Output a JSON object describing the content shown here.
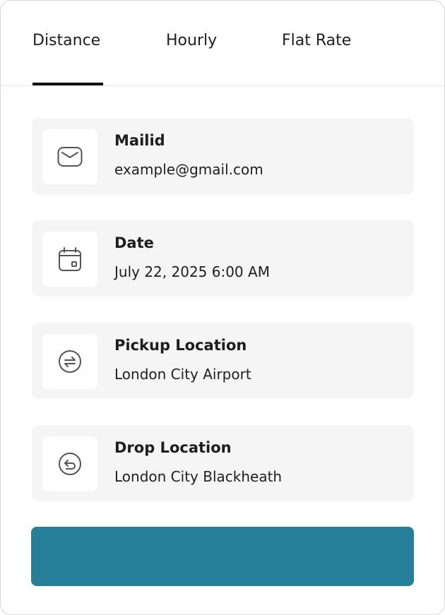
{
  "tabs": [
    {
      "label": "Distance",
      "active": true
    },
    {
      "label": "Hourly",
      "active": false
    },
    {
      "label": "Flat Rate",
      "active": false
    }
  ],
  "fields": [
    {
      "label": "Mailid",
      "value": "example@gmail.com",
      "icon": "mail-icon"
    },
    {
      "label": "Date",
      "value": "July 22, 2025 6:00 AM",
      "icon": "calendar-icon"
    },
    {
      "label": "Pickup Location",
      "value": "London City Airport",
      "icon": "pickup-location-icon"
    },
    {
      "label": "Drop Location",
      "value": "London City Blackheath",
      "icon": "drop-location-icon"
    }
  ],
  "submit_button": {
    "label": ""
  },
  "colors": {
    "accent": "#267f99",
    "row_background": "#f5f5f5",
    "active_tab_indicator": "#111111",
    "text": "#1e1e1e"
  }
}
